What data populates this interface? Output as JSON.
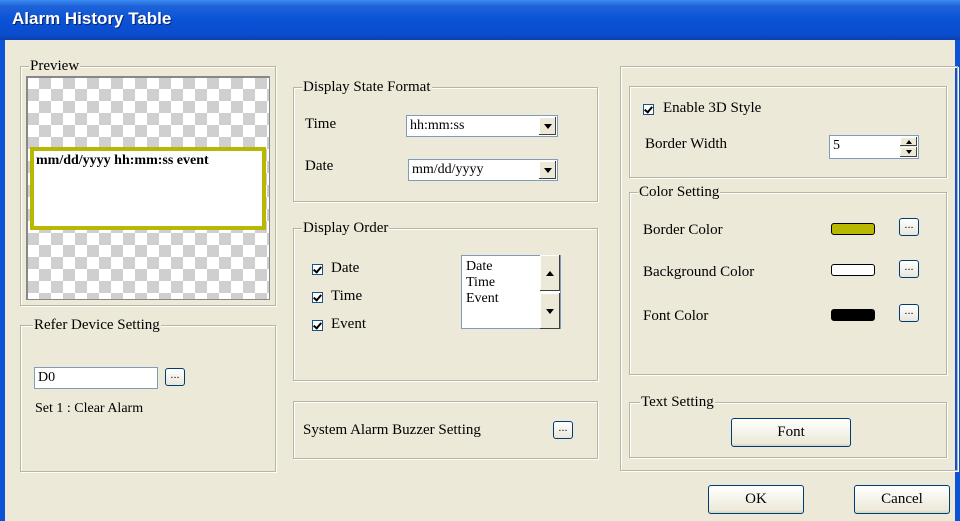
{
  "window": {
    "title": "Alarm History Table"
  },
  "preview": {
    "legend": "Preview",
    "sample_text": "mm/dd/yyyy hh:mm:ss event"
  },
  "refer_device": {
    "legend": "Refer Device Setting",
    "device_value": "D0",
    "browse_label": "...",
    "note": "Set  1 : Clear Alarm"
  },
  "display_state_format": {
    "legend": "Display State Format",
    "time_label": "Time",
    "time_value": "hh:mm:ss",
    "date_label": "Date",
    "date_value": "mm/dd/yyyy"
  },
  "display_order": {
    "legend": "Display Order",
    "checks": [
      {
        "label": "Date",
        "checked": true
      },
      {
        "label": "Time",
        "checked": true
      },
      {
        "label": "Event",
        "checked": true
      }
    ],
    "order_list": [
      "Date",
      "Time",
      "Event"
    ]
  },
  "buzzer": {
    "label": "System Alarm Buzzer Setting",
    "browse_label": "..."
  },
  "style": {
    "enable_3d_label": "Enable 3D Style",
    "enable_3d_checked": true,
    "border_width_label": "Border Width",
    "border_width_value": "5"
  },
  "color_setting": {
    "legend": "Color Setting",
    "border_label": "Border Color",
    "border_color": "#b8b800",
    "background_label": "Background Color",
    "background_color": "#ffffff",
    "font_label": "Font Color",
    "font_color": "#000000",
    "browse_label": "..."
  },
  "text_setting": {
    "legend": "Text Setting",
    "font_button": "Font"
  },
  "footer": {
    "ok_label": "OK",
    "cancel_label": "Cancel"
  }
}
